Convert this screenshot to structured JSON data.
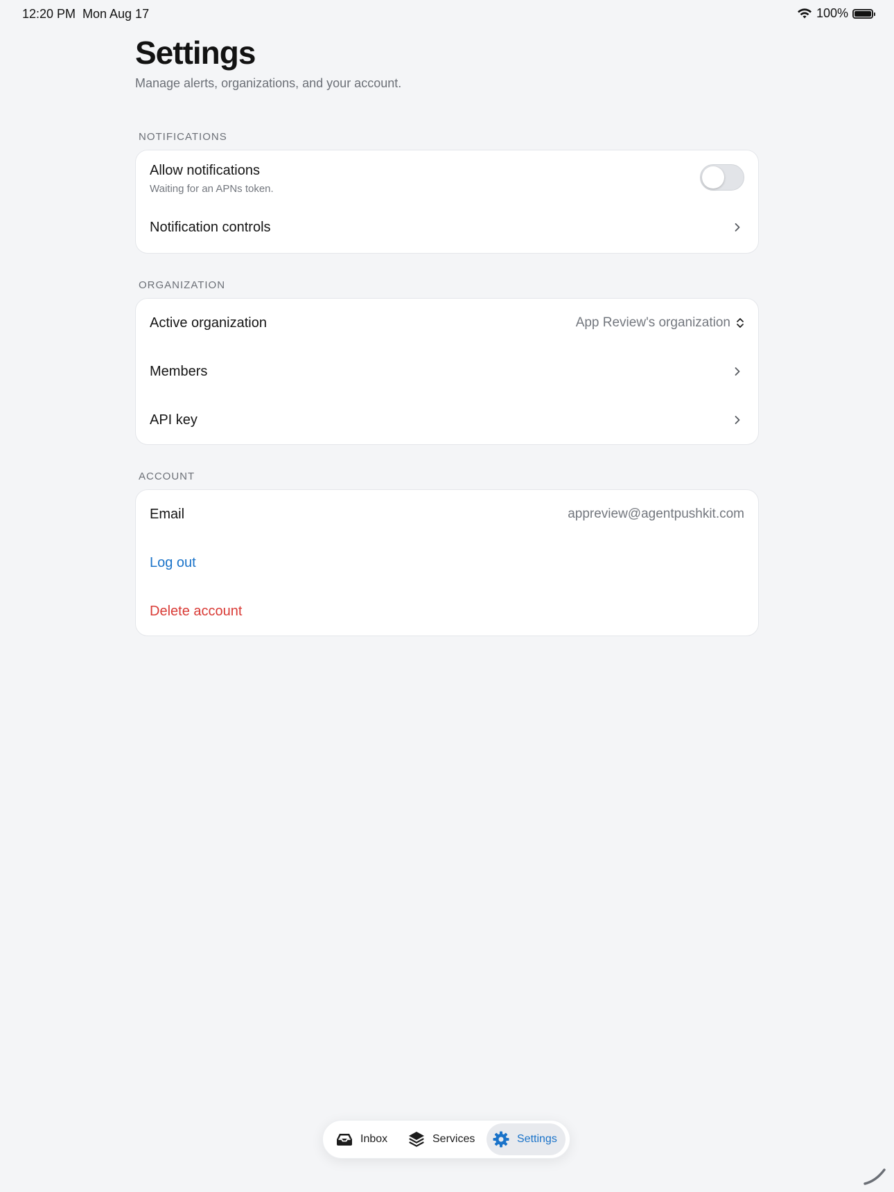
{
  "status_bar": {
    "time": "12:20 PM",
    "date": "Mon Aug 17",
    "battery": "100%"
  },
  "header": {
    "title": "Settings",
    "subtitle": "Manage alerts, organizations, and your account."
  },
  "sections": {
    "notifications": {
      "header": "NOTIFICATIONS",
      "allow_label": "Allow notifications",
      "allow_sublabel": "Waiting for an APNs token.",
      "allow_enabled": false,
      "controls_label": "Notification controls"
    },
    "organization": {
      "header": "ORGANIZATION",
      "active_label": "Active organization",
      "active_value": "App Review's organization",
      "members_label": "Members",
      "api_key_label": "API key"
    },
    "account": {
      "header": "ACCOUNT",
      "email_label": "Email",
      "email_value": "appreview@agentpushkit.com",
      "logout_label": "Log out",
      "delete_label": "Delete account"
    }
  },
  "tab_bar": {
    "tabs": [
      {
        "label": "Inbox",
        "icon": "inbox-tray-icon"
      },
      {
        "label": "Services",
        "icon": "layers-icon"
      },
      {
        "label": "Settings",
        "icon": "gear-icon",
        "selected": true
      }
    ]
  },
  "colors": {
    "accent_blue": "#1a73c9",
    "destructive_red": "#d93a35",
    "background": "#f4f5f7"
  }
}
